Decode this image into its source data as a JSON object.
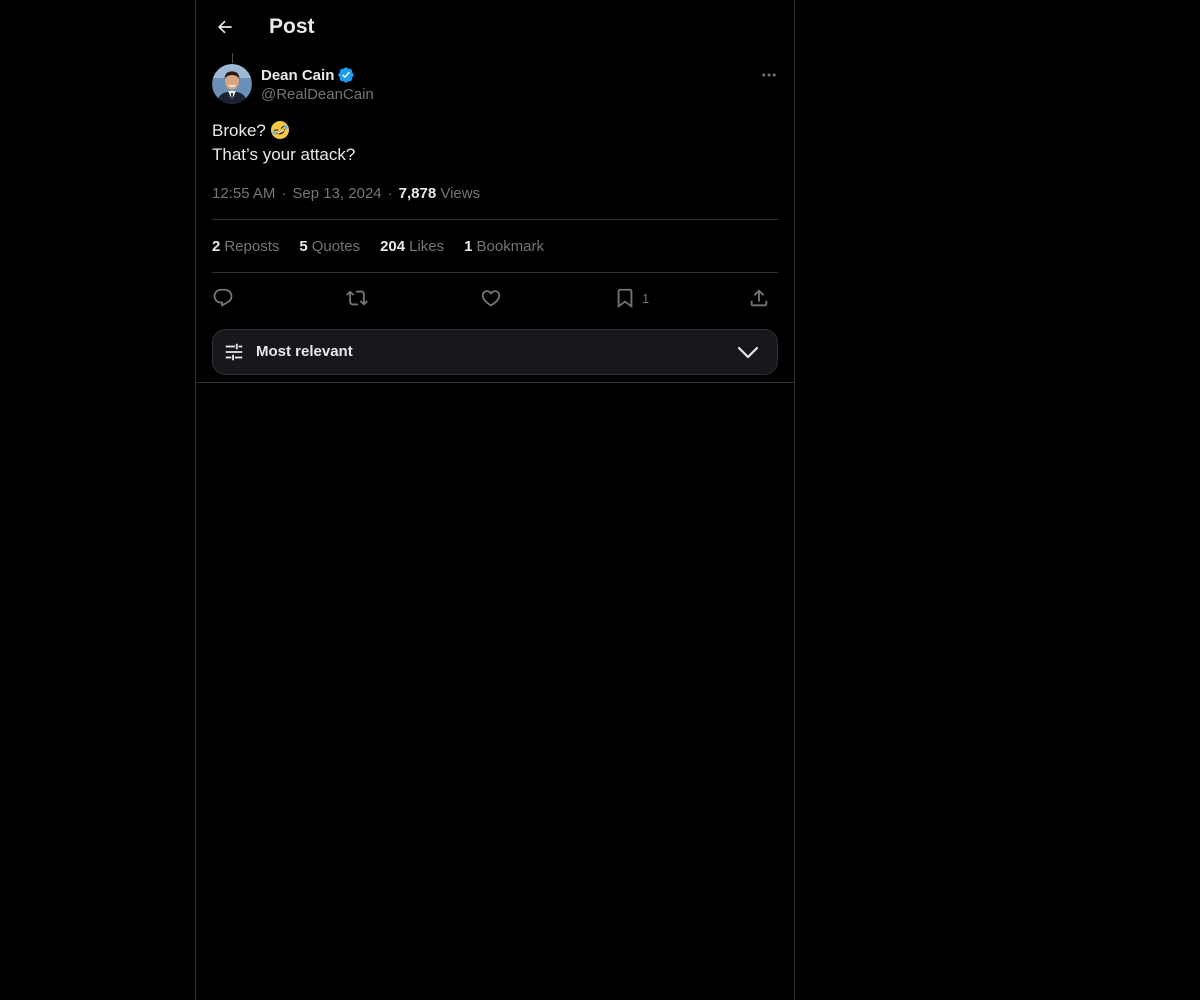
{
  "header": {
    "title": "Post",
    "back_icon": "arrow-left-icon"
  },
  "post": {
    "author": {
      "display_name": "Dean Cain",
      "handle": "@RealDeanCain",
      "verified": true,
      "verified_color": "#1d9bf0"
    },
    "text_lines": [
      "Broke?",
      "That’s your attack?"
    ],
    "emoji": "rolling-on-floor-laughing-emoji",
    "time": "12:55 AM",
    "date": "Sep 13, 2024",
    "separator": "·",
    "views_count": "7,878",
    "views_label": "Views"
  },
  "stats": {
    "reposts": {
      "count": "2",
      "label": "Reposts"
    },
    "quotes": {
      "count": "5",
      "label": "Quotes"
    },
    "likes": {
      "count": "204",
      "label": "Likes"
    },
    "bookmarks": {
      "count": "1",
      "label": "Bookmark"
    }
  },
  "actions": {
    "reply_icon": "reply-icon",
    "repost_icon": "repost-icon",
    "like_icon": "heart-icon",
    "bookmark_icon": "bookmark-icon",
    "bookmark_count": "1",
    "share_icon": "share-icon"
  },
  "sort": {
    "label": "Most relevant",
    "icon": "sliders-icon",
    "chevron": "chevron-down-icon"
  },
  "colors": {
    "background": "#000000",
    "text_primary": "#e7e9ea",
    "text_secondary": "#71767b",
    "border": "#2f3336",
    "accent": "#1d9bf0"
  }
}
